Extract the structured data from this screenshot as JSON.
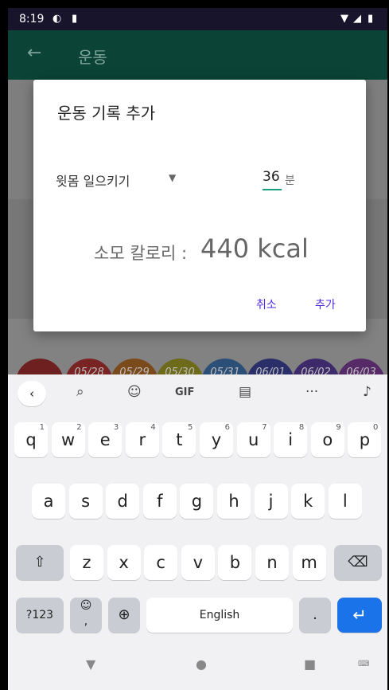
{
  "status_bar": {
    "time": "8:19"
  },
  "app_bar": {
    "title": "운동",
    "back_icon": "arrow-left-icon"
  },
  "dialog": {
    "title": "운동 기록 추가",
    "exercise": "윗몸 일으키기",
    "minutes_value": "36",
    "minutes_unit": "분",
    "calorie_label": "소모 칼로리 :",
    "calorie_value": "440 kcal",
    "cancel_label": "취소",
    "add_label": "추가"
  },
  "date_chips": [
    "05/28",
    "05/29",
    "05/30",
    "05/31",
    "06/01",
    "06/02",
    "06/03"
  ],
  "date_colors": [
    "#7a2323",
    "#7a4a1b",
    "#7a6a1a",
    "#2f5d2a",
    "#244a7a",
    "#3a2c6a",
    "#5a2a6a"
  ],
  "keyboard": {
    "toolbar": {
      "gif_label": "GIF",
      "more_label": "···"
    },
    "row1": [
      {
        "k": "q",
        "h": "1"
      },
      {
        "k": "w",
        "h": "2"
      },
      {
        "k": "e",
        "h": "3"
      },
      {
        "k": "r",
        "h": "4"
      },
      {
        "k": "t",
        "h": "5"
      },
      {
        "k": "y",
        "h": "6"
      },
      {
        "k": "u",
        "h": "7"
      },
      {
        "k": "i",
        "h": "8"
      },
      {
        "k": "o",
        "h": "9"
      },
      {
        "k": "p",
        "h": "0"
      }
    ],
    "row2": [
      "a",
      "s",
      "d",
      "f",
      "g",
      "h",
      "j",
      "k",
      "l"
    ],
    "row3": [
      "z",
      "x",
      "c",
      "v",
      "b",
      "n",
      "m"
    ],
    "symbols_label": "?123",
    "space_label": "English",
    "period_label": "."
  }
}
